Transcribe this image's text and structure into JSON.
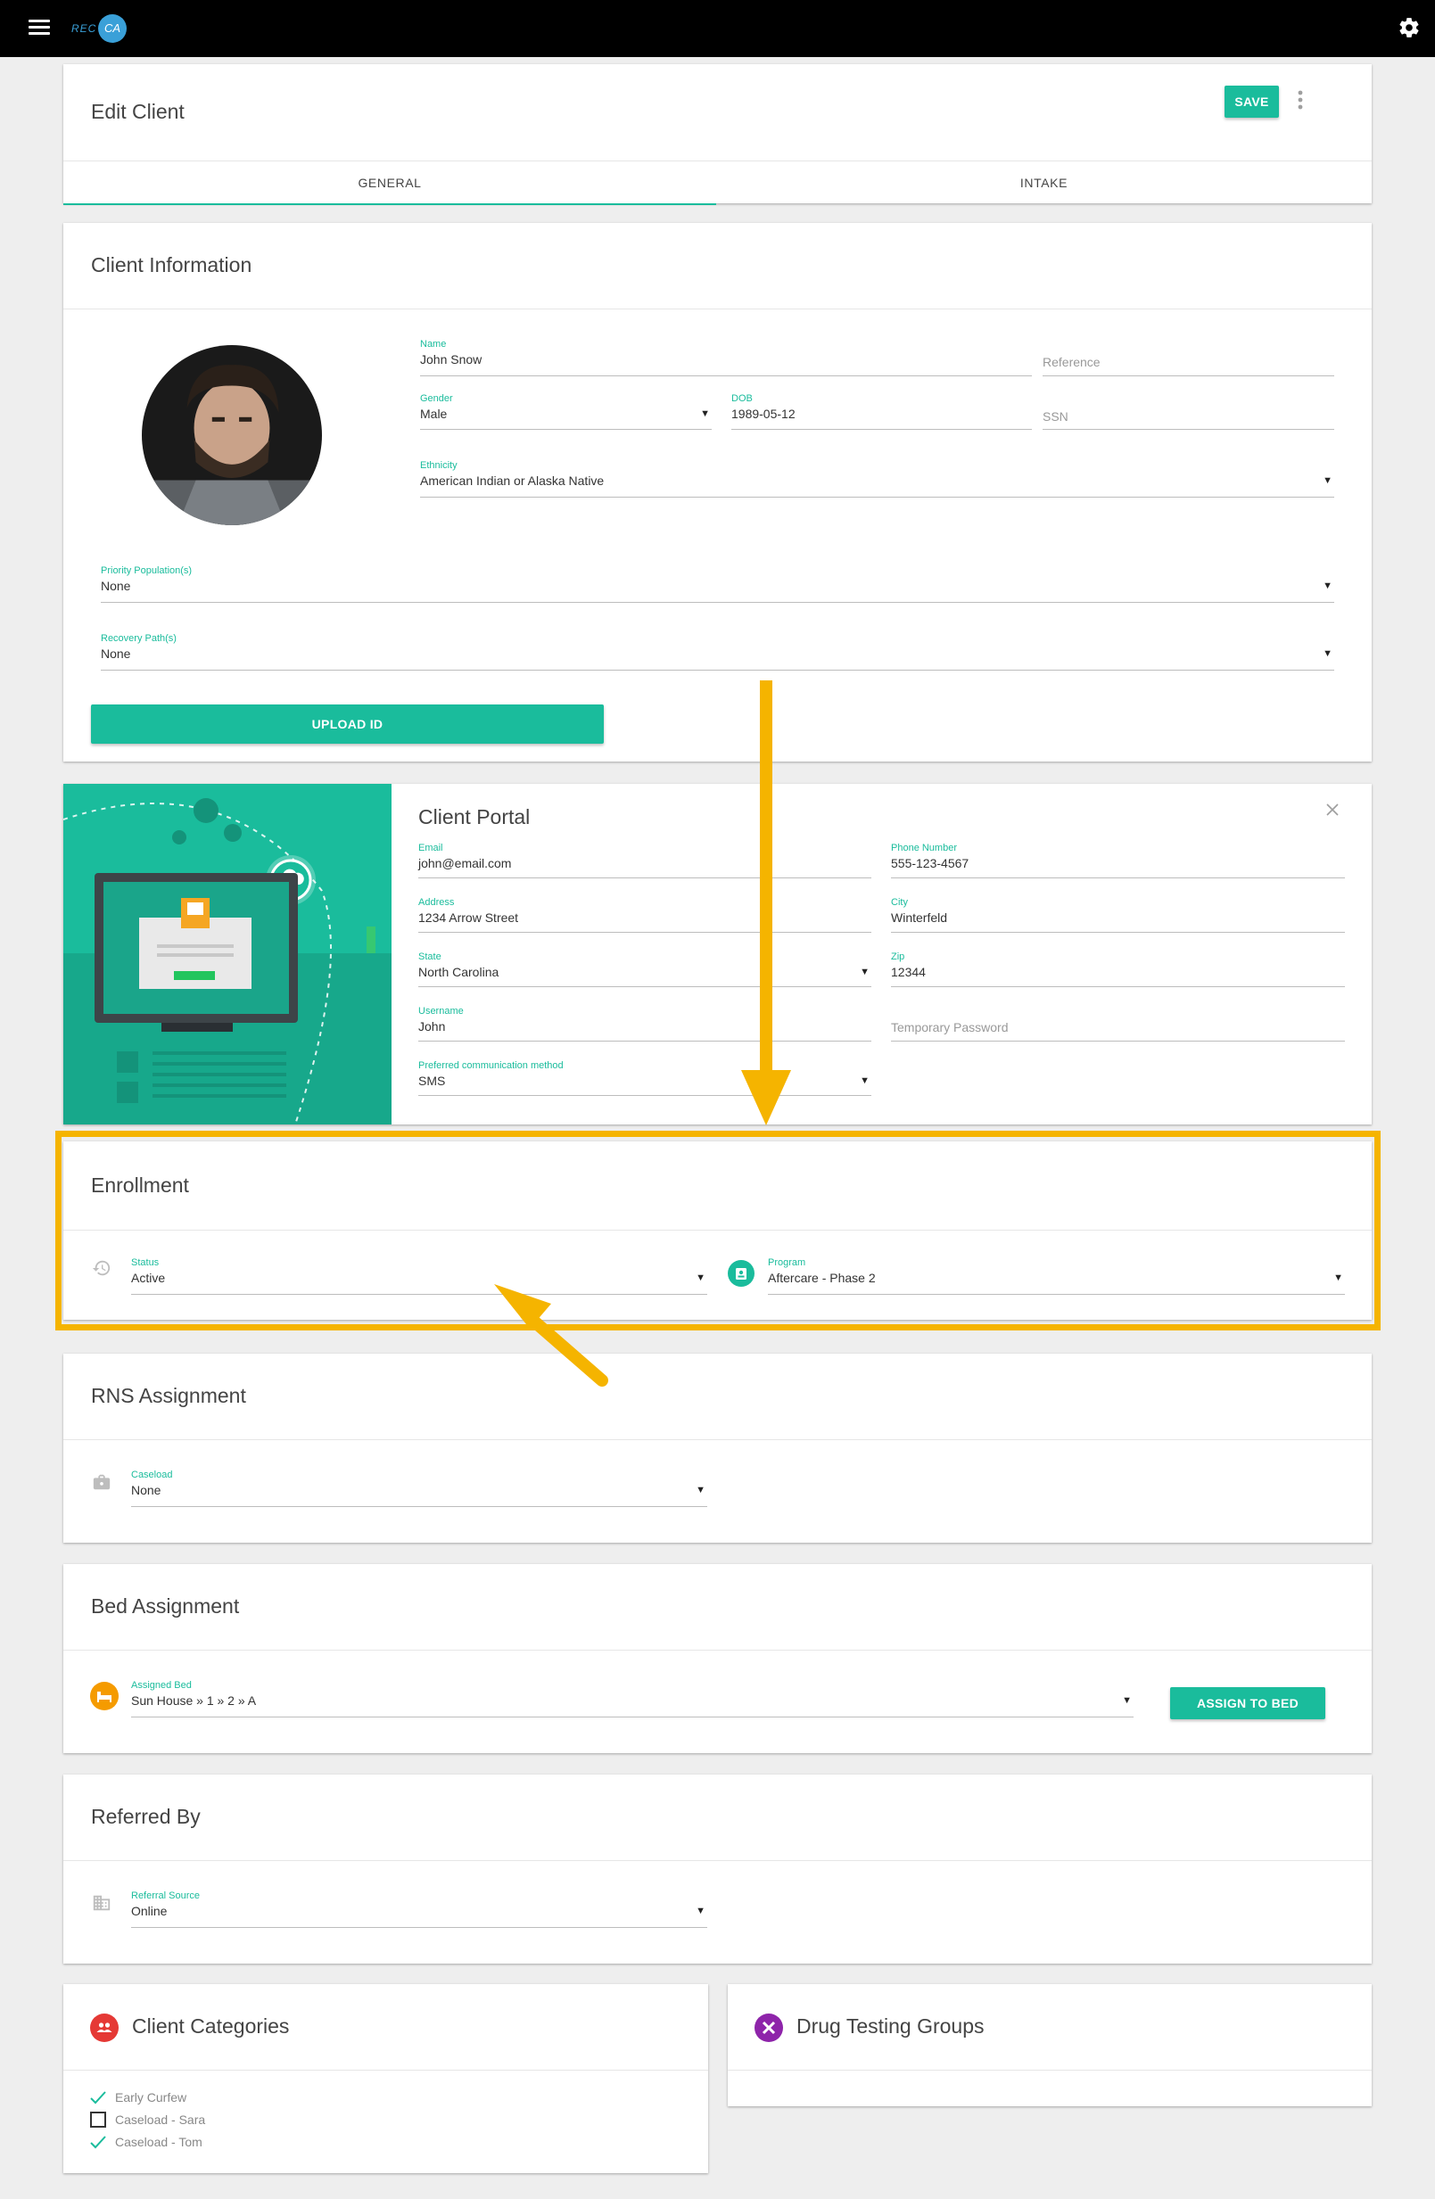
{
  "app": {
    "logo_text": "REC",
    "logo_mark": "CA",
    "menu_icon": "menu-icon",
    "settings_icon": "gear-icon"
  },
  "header": {
    "title": "Edit Client",
    "save_label": "SAVE",
    "more_icon": "more-vert-icon"
  },
  "tabs": [
    {
      "label": "GENERAL",
      "active": true
    },
    {
      "label": "INTAKE",
      "active": false
    }
  ],
  "client_info": {
    "title": "Client Information",
    "name": {
      "label": "Name",
      "value": "John Snow"
    },
    "reference": {
      "placeholder": "Reference"
    },
    "gender": {
      "label": "Gender",
      "value": "Male"
    },
    "dob": {
      "label": "DOB",
      "value": "1989-05-12"
    },
    "ssn": {
      "placeholder": "SSN"
    },
    "ethnicity": {
      "label": "Ethnicity",
      "value": "American Indian or Alaska Native"
    },
    "priority_population": {
      "label": "Priority Population(s)",
      "value": "None"
    },
    "recovery_path": {
      "label": "Recovery Path(s)",
      "value": "None"
    },
    "upload_label": "UPLOAD ID"
  },
  "client_portal": {
    "title": "Client Portal",
    "close_icon": "close-icon",
    "email": {
      "label": "Email",
      "value": "john@email.com"
    },
    "phone": {
      "label": "Phone Number",
      "value": "555-123-4567"
    },
    "address": {
      "label": "Address",
      "value": "1234 Arrow Street"
    },
    "city": {
      "label": "City",
      "value": "Winterfeld"
    },
    "state": {
      "label": "State",
      "value": "North Carolina"
    },
    "zip": {
      "label": "Zip",
      "value": "12344"
    },
    "username": {
      "label": "Username",
      "value": "John"
    },
    "temp_password": {
      "placeholder": "Temporary Password"
    },
    "comm_method": {
      "label": "Preferred communication method",
      "value": "SMS"
    }
  },
  "enrollment": {
    "title": "Enrollment",
    "status": {
      "label": "Status",
      "value": "Active",
      "icon": "history-icon"
    },
    "program": {
      "label": "Program",
      "value": "Aftercare - Phase 2",
      "icon": "program-badge-icon"
    }
  },
  "rns": {
    "title": "RNS Assignment",
    "caseload": {
      "label": "Caseload",
      "value": "None",
      "icon": "briefcase-icon"
    }
  },
  "bed": {
    "title": "Bed Assignment",
    "assigned_bed": {
      "label": "Assigned Bed",
      "value": "Sun House » 1 » 2 » A",
      "icon": "bed-icon"
    },
    "assign_label": "ASSIGN TO BED"
  },
  "referred": {
    "title": "Referred By",
    "source": {
      "label": "Referral Source",
      "value": "Online",
      "icon": "building-icon"
    }
  },
  "categories": {
    "title": "Client Categories",
    "icon": "people-icon",
    "items": [
      {
        "label": "Early Curfew",
        "checked": true
      },
      {
        "label": "Caseload - Sara",
        "checked": false
      },
      {
        "label": "Caseload - Tom",
        "checked": true
      }
    ]
  },
  "drug_testing": {
    "title": "Drug Testing Groups",
    "icon": "test-tube-icon"
  },
  "colors": {
    "accent": "#1abc9c",
    "highlight": "#f5b400",
    "topbar": "#000000",
    "categories_badge": "#e53935",
    "drug_badge": "#8e24aa",
    "bed_badge": "#f59b00"
  }
}
